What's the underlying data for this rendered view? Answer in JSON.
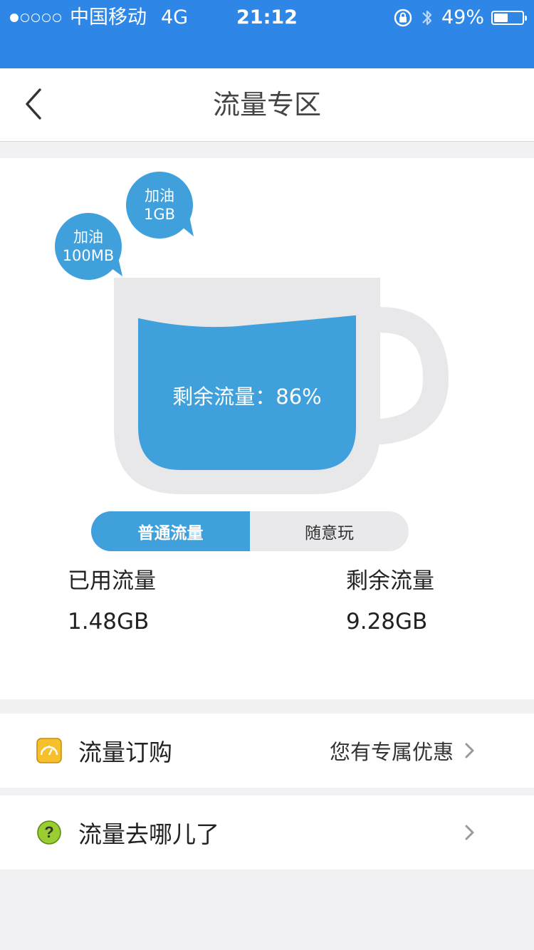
{
  "status_bar": {
    "carrier": "中国移动",
    "network": "4G",
    "time": "21:12",
    "battery_percent_text": "49%",
    "battery_level": 0.49,
    "signal_bars_filled": 1,
    "signal_bars_total": 5,
    "icons": [
      "orientation-lock-icon",
      "bluetooth-icon",
      "battery-icon"
    ]
  },
  "nav": {
    "title": "流量专区",
    "back_icon": "chevron-left-icon"
  },
  "cup": {
    "remaining_label": "剩余流量：86%",
    "remaining_fraction": 0.86,
    "bubbles": [
      {
        "line1": "加油",
        "line2": "100MB"
      },
      {
        "line1": "加油",
        "line2": "1GB"
      }
    ]
  },
  "toggle": {
    "options": [
      "普通流量",
      "随意玩"
    ],
    "selected": "普通流量"
  },
  "stats": {
    "used_label": "已用流量",
    "used_value": "1.48GB",
    "remaining_label": "剩余流量",
    "remaining_value": "9.28GB"
  },
  "menu": {
    "items": [
      {
        "title": "流量订购",
        "hint": "您有专属优惠",
        "icon": "speedometer-icon"
      },
      {
        "title": "流量去哪儿了",
        "hint": "",
        "icon": "question-icon"
      }
    ]
  },
  "colors": {
    "status_bar": "#2e86e6",
    "water": "#3fa0db",
    "cup_body": "#e8e8eb",
    "page_bg": "#f1f1f3"
  }
}
